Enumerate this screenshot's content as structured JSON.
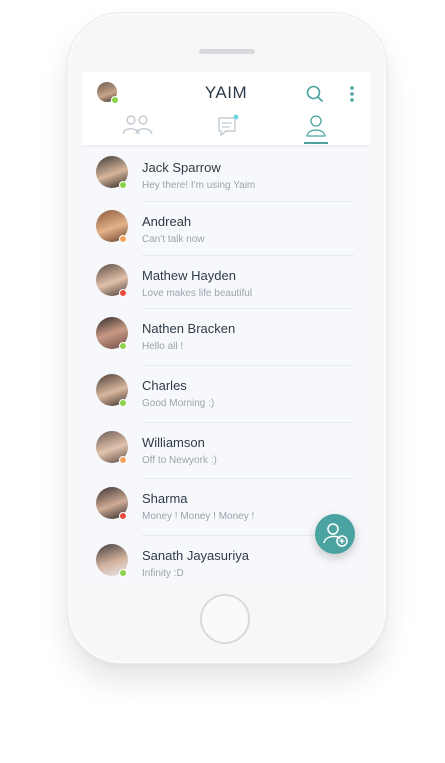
{
  "app": {
    "title": "YAIM"
  },
  "header": {
    "search_icon": "search-icon",
    "menu_icon": "more-vertical-icon"
  },
  "tabs": [
    {
      "id": "groups",
      "icon": "group-icon"
    },
    {
      "id": "chats",
      "icon": "chat-icon"
    },
    {
      "id": "contacts",
      "icon": "user-icon",
      "selected": true
    }
  ],
  "contacts": [
    {
      "name": "Jack Sparrow",
      "status": "Hey there! I'm using Yaim",
      "presence": "online"
    },
    {
      "name": "Andreah",
      "status": "Can't talk now",
      "presence": "away"
    },
    {
      "name": "Mathew Hayden",
      "status": "Love makes life beautiful",
      "presence": "busy"
    },
    {
      "name": "Nathen Bracken",
      "status": "Hello all !",
      "presence": "online"
    },
    {
      "name": "Charles",
      "status": "Good Morning :)",
      "presence": "online"
    },
    {
      "name": "Williamson",
      "status": "Off to Newyork :)",
      "presence": "away"
    },
    {
      "name": "Sharma",
      "status": "Money ! Money ! Money !",
      "presence": "busy"
    },
    {
      "name": "Sanath Jayasuriya",
      "status": "Infinity :D",
      "presence": "online"
    }
  ],
  "colors": {
    "accent": "#4aa3a0",
    "online": "#8bd34a",
    "away": "#f5a25d",
    "busy": "#e84a3c"
  },
  "fab": {
    "icon": "add-user-icon"
  }
}
